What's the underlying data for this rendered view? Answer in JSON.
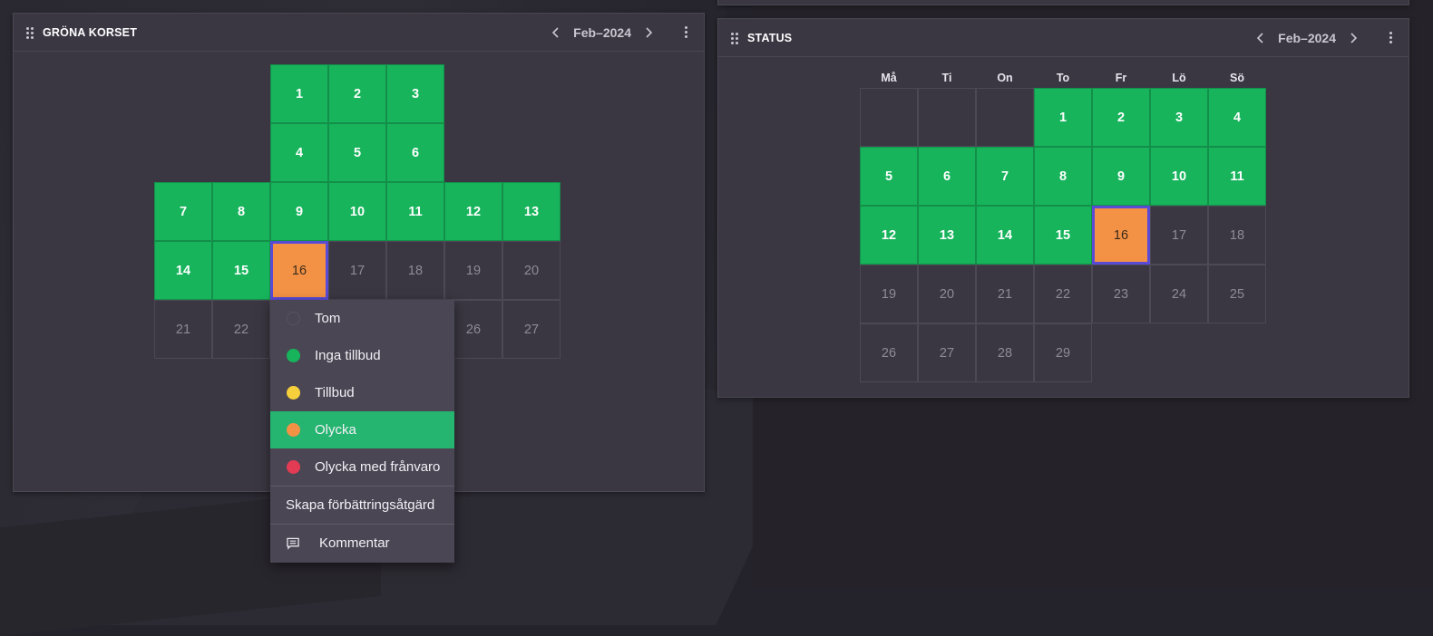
{
  "colors": {
    "green": "#17b45c",
    "orange": "#f39245",
    "selection": "#5a4bd6",
    "menu_active": "#26b570"
  },
  "left_panel": {
    "title": "GRÖNA KORSET",
    "month": "Feb–2024",
    "cells": {
      "d1": "1",
      "d2": "2",
      "d3": "3",
      "d4": "4",
      "d5": "5",
      "d6": "6",
      "d7": "7",
      "d8": "8",
      "d9": "9",
      "d10": "10",
      "d11": "11",
      "d12": "12",
      "d13": "13",
      "d14": "14",
      "d15": "15",
      "d16": "16",
      "d17": "17",
      "d18": "18",
      "d19": "19",
      "d20": "20",
      "d21": "21",
      "d22": "22",
      "d26": "26",
      "d27": "27"
    }
  },
  "right_panel": {
    "title": "STATUS",
    "month": "Feb–2024",
    "weekdays": [
      "Må",
      "Ti",
      "On",
      "To",
      "Fr",
      "Lö",
      "Sö"
    ],
    "days": [
      "1",
      "2",
      "3",
      "4",
      "5",
      "6",
      "7",
      "8",
      "9",
      "10",
      "11",
      "12",
      "13",
      "14",
      "15",
      "16",
      "17",
      "18",
      "19",
      "20",
      "21",
      "22",
      "23",
      "24",
      "25",
      "26",
      "27",
      "28",
      "29"
    ]
  },
  "context_menu": {
    "items": [
      {
        "label": "Tom",
        "color": "#4a4653"
      },
      {
        "label": "Inga tillbud",
        "color": "#17b45c"
      },
      {
        "label": "Tillbud",
        "color": "#f5cf3c"
      },
      {
        "label": "Olycka",
        "color": "#f39245"
      },
      {
        "label": "Olycka med frånvaro",
        "color": "#e33b54"
      }
    ],
    "improve_label": "Skapa förbättringsåtgärd",
    "comment_label": "Kommentar",
    "comment_icon": "comment-icon"
  }
}
